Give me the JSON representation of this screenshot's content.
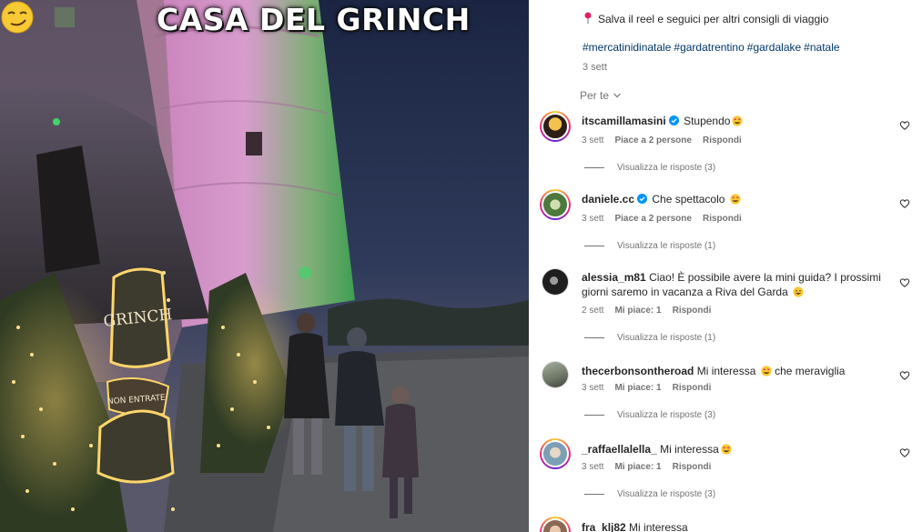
{
  "media": {
    "overlay_title": "CASA DEL GRINCH",
    "overlay_emoji": "smirking-face-emoji",
    "sign_text_1": "GRINCH",
    "sign_text_2": "NON ENTRATE"
  },
  "caption": {
    "pin_icon": "pushpin-icon",
    "text": "Salva il reel e seguici per altri consigli di viaggio",
    "hashtags": [
      "#mercatinidinatale",
      "#gardatrentino",
      "#gardalake",
      "#natale"
    ],
    "time": "3 sett"
  },
  "sort": {
    "label": "Per te",
    "icon": "chevron-down-icon"
  },
  "comments": [
    {
      "user": "itscamillamasini",
      "verified": true,
      "text": "Stupendo",
      "emoji": "heart-eyes",
      "time": "3 sett",
      "likes": "Piace a 2 persone",
      "reply": "Rispondi",
      "replies": "Visualizza le risposte (3)",
      "ring": true,
      "avatar_color": "#e7b22a"
    },
    {
      "user": "daniele.cc",
      "verified": true,
      "text": "Che spettacolo",
      "emoji": "heart-eyes",
      "time": "3 sett",
      "likes": "Piace a 2 persone",
      "reply": "Rispondi",
      "replies": "Visualizza le risposte (1)",
      "ring": true,
      "avatar_color": "#6f8f4e"
    },
    {
      "user": "alessia_m81",
      "verified": false,
      "text": "Ciao! È possibile avere la mini guida? I prossimi giorni saremo in vacanza a Riva del Garda",
      "emoji": "grinning-face",
      "time": "2 sett",
      "likes": "Mi piace: 1",
      "reply": "Rispondi",
      "replies": "Visualizza le risposte (1)",
      "ring": false,
      "avatar_color": "#2a2a2a"
    },
    {
      "user": "thecerbonsontheroad",
      "verified": false,
      "text": "Mi interessa",
      "emoji": "heart-eyes",
      "text_after": "che meraviglia",
      "time": "3 sett",
      "likes": "Mi piace: 1",
      "reply": "Rispondi",
      "replies": "Visualizza le risposte (3)",
      "ring": false,
      "avatar_color": "#8a8f83"
    },
    {
      "user": "_raffaellalella_",
      "verified": false,
      "text": "Mi interessa",
      "emoji": "heart-eyes",
      "time": "3 sett",
      "likes": "Mi piace: 1",
      "reply": "Rispondi",
      "replies": "Visualizza le risposte (3)",
      "ring": true,
      "avatar_color": "#b6c8d6"
    },
    {
      "user": "fra_klj82",
      "verified": false,
      "text": "Mi interessa",
      "emoji": "",
      "time": "",
      "likes": "",
      "reply": "",
      "replies": "",
      "ring": true,
      "avatar_color": "#c9a489"
    }
  ],
  "colors": {
    "link": "#00376b",
    "muted": "#737373",
    "verified": "#0095f6",
    "castle_glow": "#d57fc9",
    "green_light": "#3fd46a",
    "fairy_lights": "#ffd66b"
  }
}
